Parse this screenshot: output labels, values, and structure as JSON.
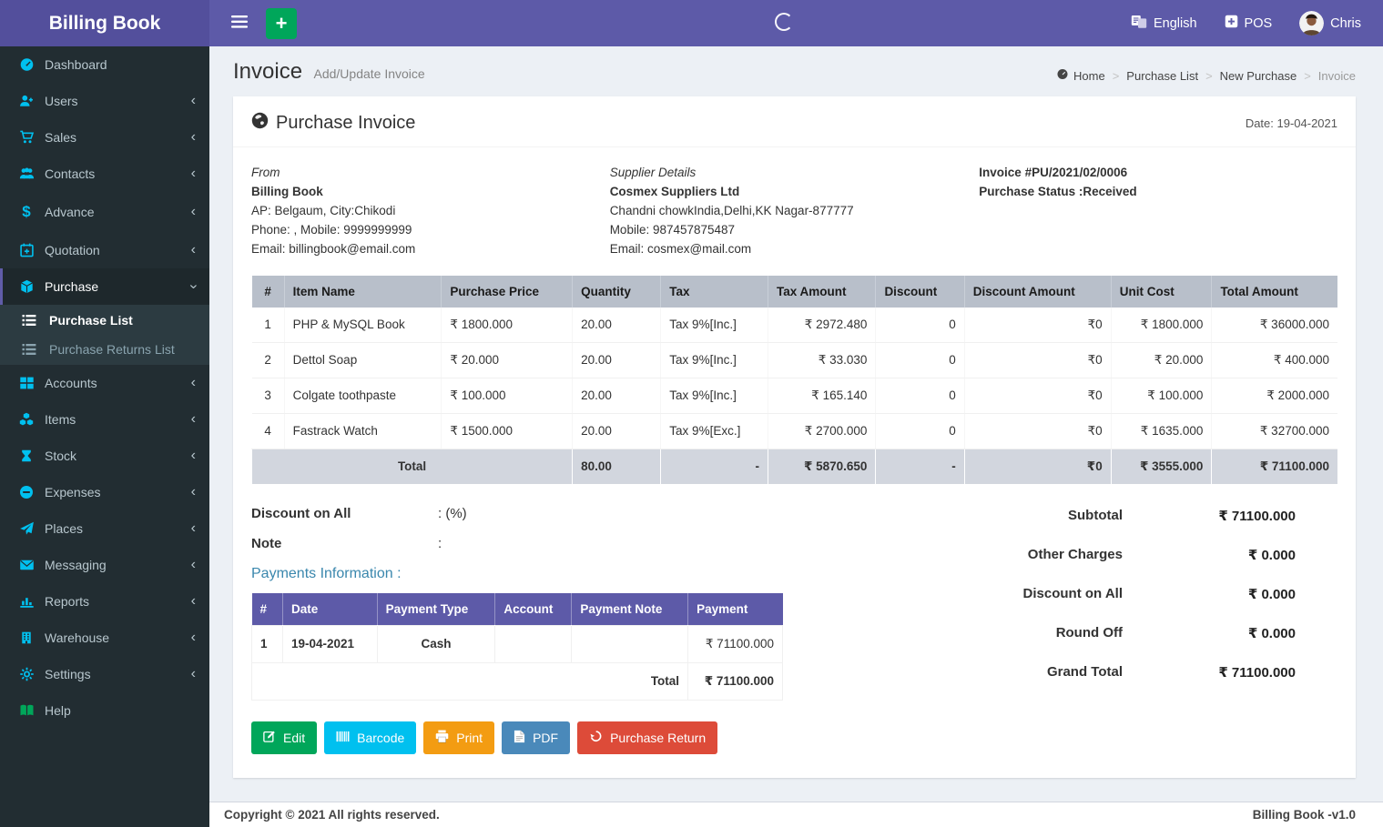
{
  "theme": {
    "topbar_purple": "#5d5aa8",
    "brand_purple": "#534f9c",
    "sidebar_dark": "#222d32",
    "sidebar_icon_cyan": "#00c0ef",
    "accent_green": "#00a65a",
    "accent_cyan": "#00c0ef",
    "accent_orange": "#f39c12",
    "accent_steel_blue": "#4a89ba",
    "accent_red": "#dd4b39",
    "items_header_gray": "#b8bfca",
    "total_row_gray": "#d2d6de"
  },
  "topbar": {
    "brand": "Billing Book",
    "language": "English",
    "pos": "POS",
    "user": "Chris"
  },
  "sidebar": {
    "items": [
      {
        "label": "Dashboard",
        "icon": "dashboard-icon"
      },
      {
        "label": "Users",
        "icon": "user-plus-icon"
      },
      {
        "label": "Sales",
        "icon": "cart-icon"
      },
      {
        "label": "Contacts",
        "icon": "users-icon"
      },
      {
        "label": "Advance",
        "icon": "dollar-icon"
      },
      {
        "label": "Quotation",
        "icon": "calendar-plus-icon"
      },
      {
        "label": "Purchase",
        "icon": "cube-icon",
        "active": true,
        "expanded": true
      },
      {
        "label": "Accounts",
        "icon": "grid-icon"
      },
      {
        "label": "Items",
        "icon": "cubes-icon"
      },
      {
        "label": "Stock",
        "icon": "hourglass-icon"
      },
      {
        "label": "Expenses",
        "icon": "minus-circle-icon"
      },
      {
        "label": "Places",
        "icon": "paper-plane-icon"
      },
      {
        "label": "Messaging",
        "icon": "envelope-icon"
      },
      {
        "label": "Reports",
        "icon": "bar-chart-icon"
      },
      {
        "label": "Warehouse",
        "icon": "building-icon"
      },
      {
        "label": "Settings",
        "icon": "gears-icon"
      },
      {
        "label": "Help",
        "icon": "book-icon"
      }
    ],
    "purchase_submenu": [
      {
        "label": "Purchase List",
        "active": true
      },
      {
        "label": "Purchase Returns List",
        "active": false
      }
    ]
  },
  "page_header": {
    "title": "Invoice",
    "subtitle": "Add/Update Invoice",
    "separator": ">",
    "breadcrumb": [
      "Home",
      "Purchase List",
      "New Purchase",
      "Invoice"
    ]
  },
  "invoice": {
    "title": "Purchase Invoice",
    "date": "Date: 19-04-2021",
    "from": {
      "heading": "From",
      "name": "Billing Book",
      "address": "AP: Belgaum, City:Chikodi",
      "phone": "Phone: , Mobile: 9999999999",
      "email": "Email: billingbook@email.com"
    },
    "supplier": {
      "heading": "Supplier Details",
      "name": "Cosmex Suppliers Ltd",
      "address": "Chandni chowkIndia,Delhi,KK Nagar-877777",
      "phone": "Mobile: 987457875487",
      "email": "Email: cosmex@mail.com"
    },
    "number": "Invoice #PU/2021/02/0006",
    "status": "Purchase Status :Received",
    "items_table": {
      "headers": [
        "#",
        "Item Name",
        "Purchase Price",
        "Quantity",
        "Tax",
        "Tax Amount",
        "Discount",
        "Discount Amount",
        "Unit Cost",
        "Total Amount"
      ],
      "rows": [
        [
          "1",
          "PHP & MySQL Book",
          "₹ 1800.000",
          "20.00",
          "Tax 9%[Inc.]",
          "₹ 2972.480",
          "0",
          "₹0",
          "₹ 1800.000",
          "₹ 36000.000"
        ],
        [
          "2",
          "Dettol Soap",
          "₹ 20.000",
          "20.00",
          "Tax 9%[Inc.]",
          "₹ 33.030",
          "0",
          "₹0",
          "₹ 20.000",
          "₹ 400.000"
        ],
        [
          "3",
          "Colgate toothpaste",
          "₹ 100.000",
          "20.00",
          "Tax 9%[Inc.]",
          "₹ 165.140",
          "0",
          "₹0",
          "₹ 100.000",
          "₹ 2000.000"
        ],
        [
          "4",
          "Fastrack Watch",
          "₹ 1500.000",
          "20.00",
          "Tax 9%[Exc.]",
          "₹ 2700.000",
          "0",
          "₹0",
          "₹ 1635.000",
          "₹ 32700.000"
        ]
      ],
      "total": {
        "label": "Total",
        "quantity": "80.00",
        "tax": "-",
        "tax_amount": "₹ 5870.650",
        "discount": "-",
        "discount_amount": "₹0",
        "unit_cost": "₹ 3555.000",
        "total_amount": "₹ 71100.000"
      }
    },
    "discount_on_all": {
      "label": "Discount on All",
      "value": ": (%)"
    },
    "note": {
      "label": "Note",
      "value": ":"
    },
    "payments": {
      "title": "Payments Information :",
      "headers": [
        "#",
        "Date",
        "Payment Type",
        "Account",
        "Payment Note",
        "Payment"
      ],
      "rows": [
        [
          "1",
          "19-04-2021",
          "Cash",
          "",
          "",
          "₹ 71100.000"
        ]
      ],
      "total_label": "Total",
      "total_value": "₹ 71100.000"
    },
    "summary": [
      {
        "label": "Subtotal",
        "value": "₹ 71100.000"
      },
      {
        "label": "Other Charges",
        "value": "₹ 0.000"
      },
      {
        "label": "Discount on All",
        "value": "₹ 0.000"
      },
      {
        "label": "Round Off",
        "value": "₹ 0.000"
      },
      {
        "label": "Grand Total",
        "value": "₹ 71100.000"
      }
    ],
    "actions": [
      {
        "label": "Edit",
        "icon": "edit-icon"
      },
      {
        "label": "Barcode",
        "icon": "barcode-icon"
      },
      {
        "label": "Print",
        "icon": "print-icon"
      },
      {
        "label": "PDF",
        "icon": "pdf-icon"
      },
      {
        "label": "Purchase Return",
        "icon": "undo-icon"
      }
    ]
  },
  "footer": {
    "left": "Copyright © 2021 All rights reserved.",
    "right": "Billing Book -v1.0"
  }
}
